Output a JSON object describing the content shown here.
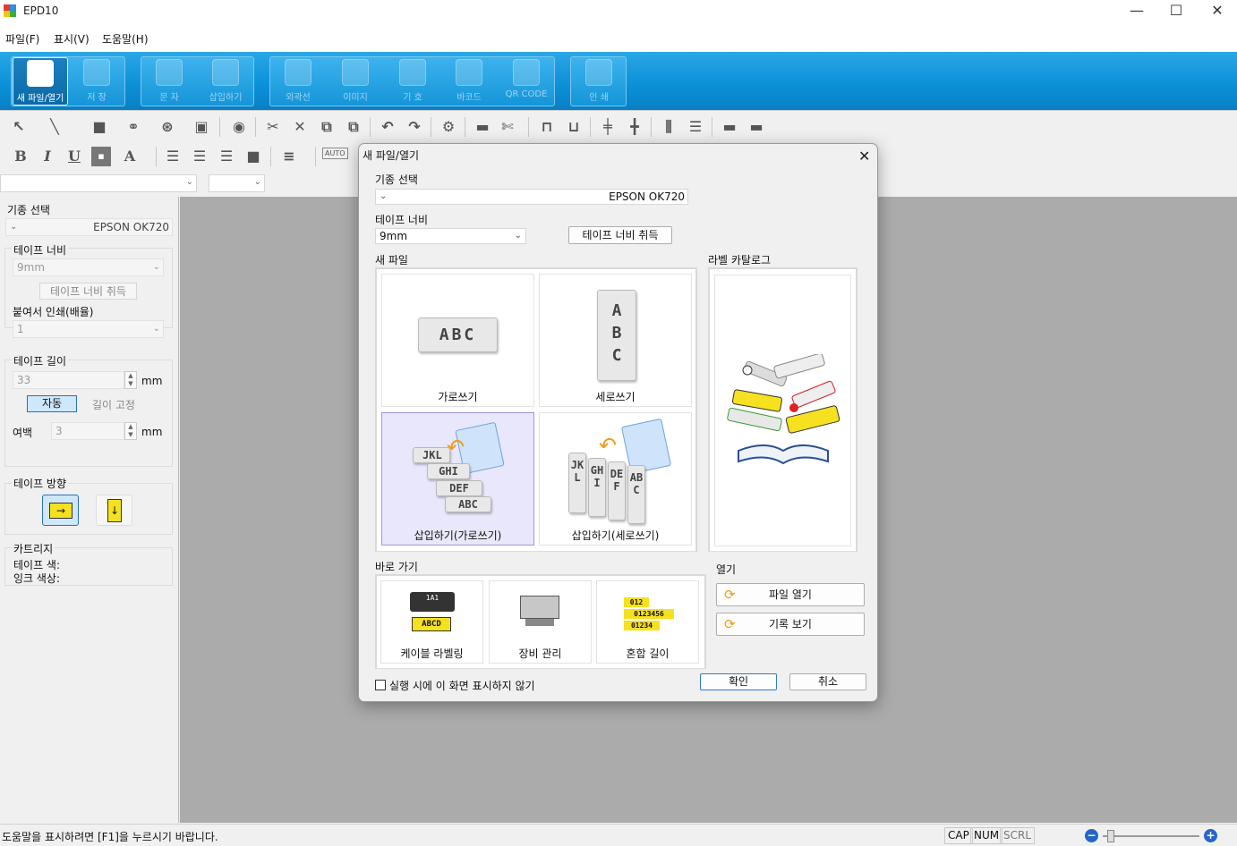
{
  "window": {
    "title": "EPD10",
    "minimize": "—",
    "maximize": "☐",
    "close": "✕"
  },
  "menu": [
    "파일(F)",
    "표시(V)",
    "도움말(H)"
  ],
  "ribbon": {
    "new_open": "새 파일/열기",
    "save": "저 장",
    "text": "문 자",
    "insert": "삽입하기",
    "frame": "외곽선",
    "image": "이미지",
    "symbol": "기 호",
    "barcode": "바코드",
    "qrcode": "QR CODE",
    "print": "인 쇄"
  },
  "format_toolbar": {
    "bold": "B",
    "italic": "I",
    "underline": "U",
    "font": "A",
    "auto": "AUTO"
  },
  "left_panel": {
    "model_label": "기종 선택",
    "model_value": "EPSON OK720",
    "tape_width_label": "테이프 너비",
    "tape_width_value": "9mm",
    "get_width_button": "테이프 너비 취득",
    "copies_label": "붙여서 인쇄(배율)",
    "copies_value": "1",
    "tape_length_label": "테이프 길이",
    "tape_length_value": "33",
    "unit_mm": "mm",
    "auto_button": "자동",
    "fixed_length_button": "길이 고정",
    "margin_label": "여백",
    "margin_value": "3",
    "direction_label": "테이프 방향",
    "cartridge_label": "카트리지",
    "tape_color_label": "테이프 색:",
    "ink_color_label": "잉크 색상:"
  },
  "dialog": {
    "title": "새 파일/열기",
    "close": "✕",
    "model_label": "기종 선택",
    "model_value": "EPSON OK720",
    "tape_width_label": "테이프 너비",
    "tape_width_value": "9mm",
    "get_width_button": "테이프 너비 취득",
    "new_file_label": "새 파일",
    "catalog_label": "라벨 카탈로그",
    "tiles": {
      "horizontal": "가로쓰기",
      "vertical": "세로쓰기",
      "insert_horizontal": "삽입하기(가로쓰기)",
      "insert_vertical": "삽입하기(세로쓰기)"
    },
    "sample_text": {
      "abc": "ABC",
      "a": "A",
      "b": "B",
      "c": "C",
      "jkl": "JKL",
      "ghi": "GHI",
      "def": "DEF"
    },
    "shortcut_label": "바로 가기",
    "shortcuts": {
      "cable": "케이블 라벨링",
      "equipment": "장비 관리",
      "mixed": "혼합 길이"
    },
    "shortcut_samples": {
      "cable_top": "1A1",
      "cable_mid": "ABCD",
      "mixed_1": "012",
      "mixed_2": "0123456",
      "mixed_3": "01234"
    },
    "open_label": "열기",
    "open_file_button": "파일 열기",
    "history_button": "기록 보기",
    "dont_show_checkbox": "실행 시에 이 화면 표시하지 않기",
    "ok_button": "확인",
    "cancel_button": "취소"
  },
  "status": {
    "message": "도움말을 표시하려면 [F1]을 누르시기 바랍니다.",
    "cap": "CAP",
    "num": "NUM",
    "scrl": "SCRL"
  },
  "colors": {
    "ribbon_blue": "#0a8fd6",
    "workspace_gray": "#ababab",
    "selected_tile": "#e8e7fb",
    "label_yellow": "#f5e11f",
    "auto_button_blue": "#cfe7fb"
  }
}
